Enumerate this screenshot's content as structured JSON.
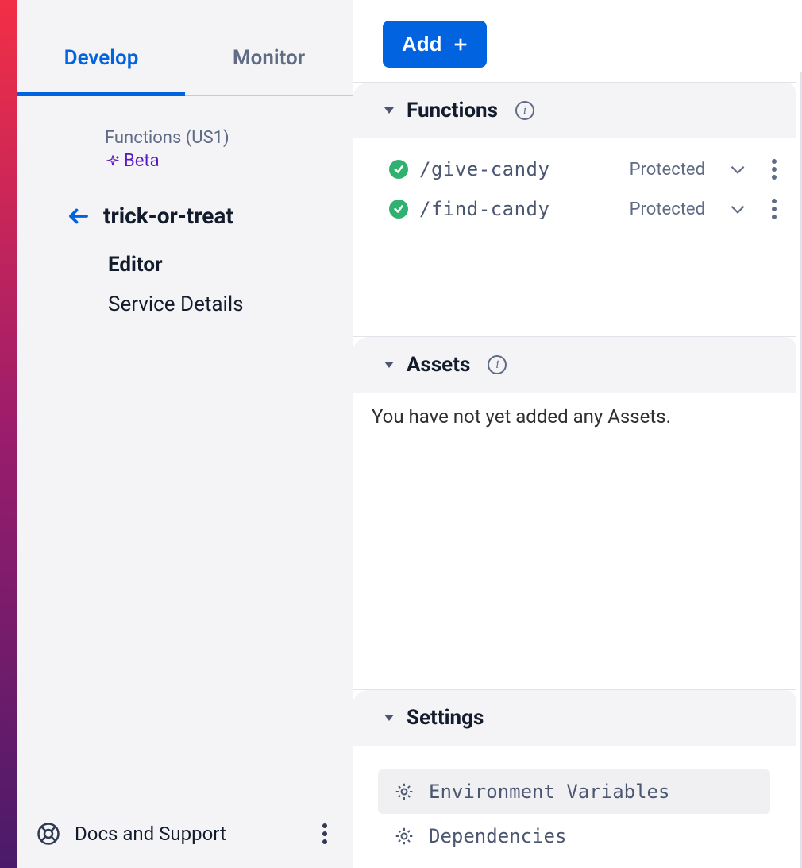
{
  "tabs": {
    "develop": "Develop",
    "monitor": "Monitor"
  },
  "crumb": {
    "label": "Functions (US1)",
    "beta": "Beta"
  },
  "service": {
    "name": "trick-or-treat"
  },
  "subnav": {
    "editor": "Editor",
    "service_details": "Service Details"
  },
  "footer": {
    "docs": "Docs and Support"
  },
  "add_button": "Add",
  "sections": {
    "functions": {
      "title": "Functions",
      "items": [
        {
          "name": "/give-candy",
          "visibility": "Protected"
        },
        {
          "name": "/find-candy",
          "visibility": "Protected"
        }
      ]
    },
    "assets": {
      "title": "Assets",
      "empty": "You have not yet added any Assets."
    },
    "settings": {
      "title": "Settings",
      "items": [
        {
          "label": "Environment Variables"
        },
        {
          "label": "Dependencies"
        }
      ]
    }
  }
}
